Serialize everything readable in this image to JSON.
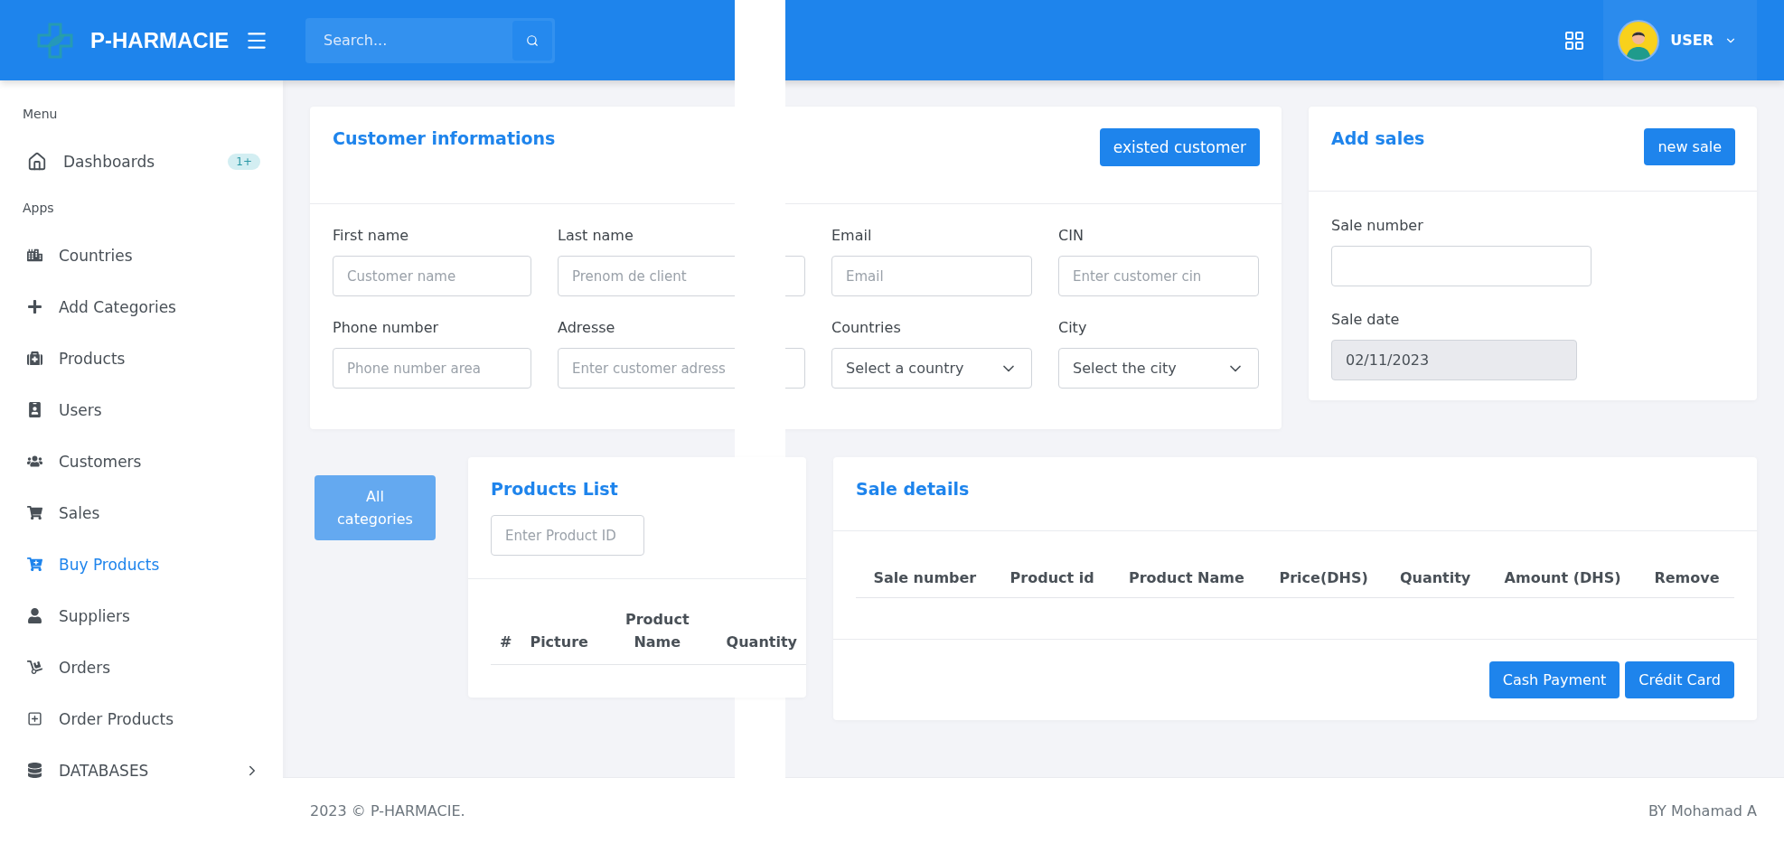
{
  "header": {
    "brand": "P-HARMACIE",
    "search": {
      "placeholder": "Search..."
    },
    "user": "USER"
  },
  "sidebar": {
    "sections": [
      {
        "title": "Menu",
        "items": [
          {
            "label": "Dashboards",
            "badge": "1+",
            "kind": "link",
            "selected": false
          }
        ]
      },
      {
        "title": "Apps",
        "items": [
          {
            "label": "Countries",
            "kind": "link",
            "selected": false
          },
          {
            "label": "Add Categories",
            "kind": "link",
            "selected": false
          },
          {
            "label": "Products",
            "kind": "link",
            "selected": false
          },
          {
            "label": "Users",
            "kind": "link",
            "selected": false
          },
          {
            "label": "Customers",
            "kind": "link",
            "selected": false
          },
          {
            "label": "Sales",
            "kind": "link",
            "selected": false
          },
          {
            "label": "Buy Products",
            "kind": "link",
            "selected": true
          },
          {
            "label": "Suppliers",
            "kind": "link",
            "selected": false
          },
          {
            "label": "Orders",
            "kind": "link",
            "selected": false
          },
          {
            "label": "Order Products",
            "kind": "link",
            "selected": false
          },
          {
            "label": "DATABASES",
            "kind": "group",
            "selected": false
          }
        ]
      }
    ]
  },
  "customer_card": {
    "title": "Customer informations",
    "button": "existed customer",
    "fields": [
      {
        "label": "First name",
        "kind": "input",
        "placeholder": "Customer name"
      },
      {
        "label": "Last name",
        "kind": "input",
        "placeholder": "Prenom de client"
      },
      {
        "label": "Email",
        "kind": "input",
        "placeholder": "Email"
      },
      {
        "label": "CIN",
        "kind": "input",
        "placeholder": "Enter customer cin"
      },
      {
        "label": "Phone number",
        "kind": "input",
        "placeholder": "Phone number area"
      },
      {
        "label": "Adresse",
        "kind": "input",
        "placeholder": "Enter customer adress"
      },
      {
        "label": "Countries",
        "kind": "select",
        "value": "Select a country"
      },
      {
        "label": "City",
        "kind": "select",
        "value": "Select the city"
      }
    ]
  },
  "sales_card": {
    "title": "Add sales",
    "button": "new sale",
    "fields": [
      {
        "label": "Sale number",
        "disabled": false
      },
      {
        "label": "Sale date",
        "value": "02/11/2023",
        "disabled": true
      }
    ]
  },
  "categories_button": "All categories",
  "products_card": {
    "title": "Products List",
    "search": {
      "placeholder": "Enter Product ID"
    },
    "columns": [
      "#",
      "Picture",
      "Product Name",
      "Quantity"
    ]
  },
  "sale_details": {
    "title": "Sale details",
    "columns": [
      "Sale number",
      "Product id",
      "Product Name",
      "Price(DHS)",
      "Quantity",
      "Amount (DHS)",
      "Remove"
    ],
    "buttons": [
      "Cash Payment",
      "Crédit Card"
    ]
  },
  "footer": {
    "left": "2023 © P-HARMACIE.",
    "right": "BY Mohamad A"
  }
}
